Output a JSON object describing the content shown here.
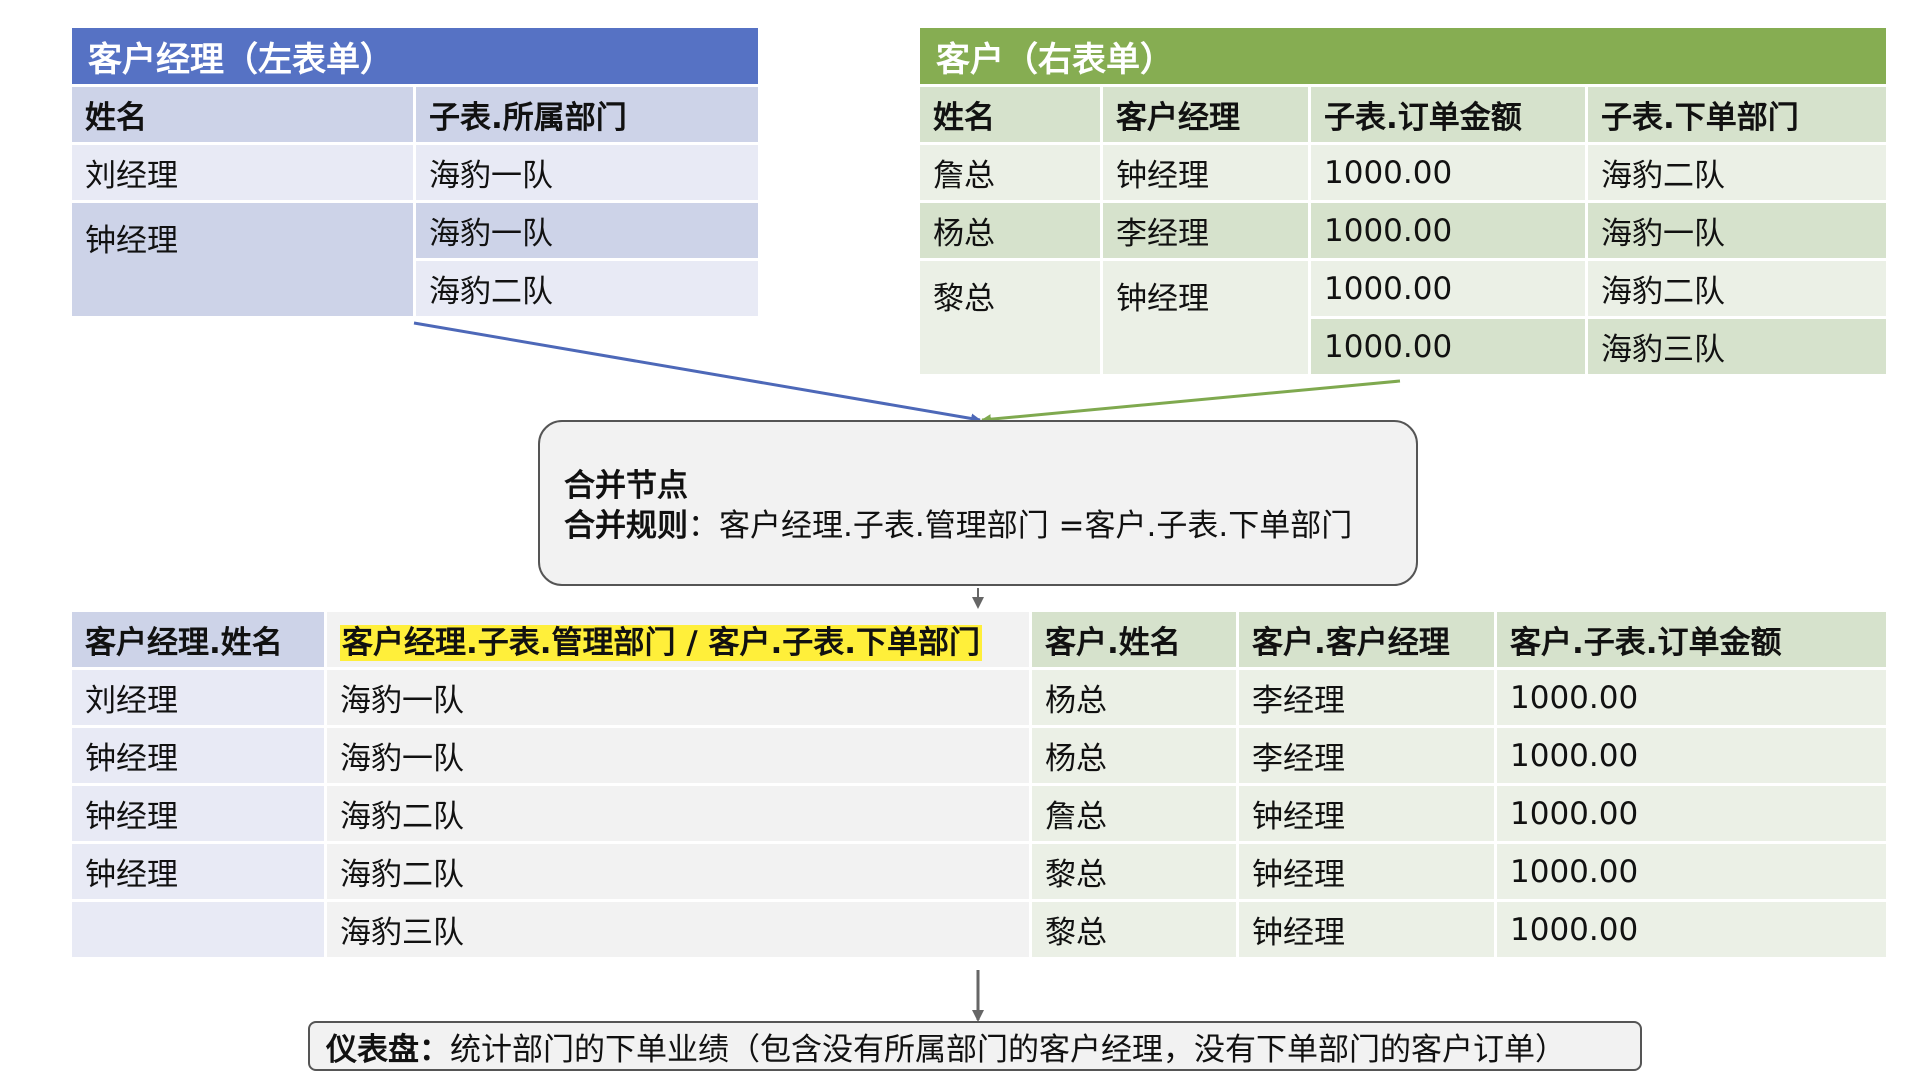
{
  "left_table": {
    "title": "客户经理（左表单）",
    "headers": [
      "姓名",
      "子表.所属部门"
    ],
    "rows": [
      [
        "刘经理",
        "海豹一队"
      ],
      [
        "钟经理",
        "海豹一队"
      ],
      [
        "",
        "海豹二队"
      ]
    ]
  },
  "right_table": {
    "title": "客户（右表单）",
    "headers": [
      "姓名",
      "客户经理",
      "子表.订单金额",
      "子表.下单部门"
    ],
    "rows": [
      [
        "詹总",
        "钟经理",
        "1000.00",
        "海豹二队"
      ],
      [
        "杨总",
        "李经理",
        "1000.00",
        "海豹一队"
      ],
      [
        "黎总",
        "钟经理",
        "1000.00",
        "海豹二队"
      ],
      [
        "",
        "",
        "1000.00",
        "海豹三队"
      ]
    ]
  },
  "merge_node": {
    "title": "合并节点",
    "rule_label": "合并规则",
    "rule_text": "：客户经理.子表.管理部门 =客户.子表.下单部门"
  },
  "result_table": {
    "headers": [
      "客户经理.姓名",
      "客户经理.子表.管理部门 / 客户.子表.下单部门",
      "客户.姓名",
      "客户.客户经理",
      "客户.子表.订单金额"
    ],
    "rows": [
      [
        "刘经理",
        "海豹一队",
        "杨总",
        "李经理",
        "1000.00"
      ],
      [
        "钟经理",
        "海豹一队",
        "杨总",
        "李经理",
        "1000.00"
      ],
      [
        "钟经理",
        "海豹二队",
        "詹总",
        "钟经理",
        "1000.00"
      ],
      [
        "钟经理",
        "海豹二队",
        "黎总",
        "钟经理",
        "1000.00"
      ],
      [
        "",
        "海豹三队",
        "黎总",
        "钟经理",
        "1000.00"
      ]
    ]
  },
  "dashboard": {
    "label": "仪表盘：",
    "text": "统计部门的下单业绩（包含没有所属部门的客户经理，没有下单部门的客户订单）"
  },
  "colors": {
    "left_title_bg": "#5672c4",
    "left_header_bg": "#cdd3e8",
    "left_cell_bg_a": "#e8eaf5",
    "left_cell_bg_b": "#cdd3e8",
    "right_title_bg": "#86ad52",
    "right_header_bg": "#d6e2cc",
    "right_cell_bg_a": "#ebf0e6",
    "right_cell_bg_b": "#d6e2cc",
    "result_neutral_bg": "#f2f2f2",
    "blue_arrow": "#4d68b8",
    "green_arrow": "#7fa94f",
    "gray_arrow": "#666666",
    "highlight": "#ffef3a"
  }
}
